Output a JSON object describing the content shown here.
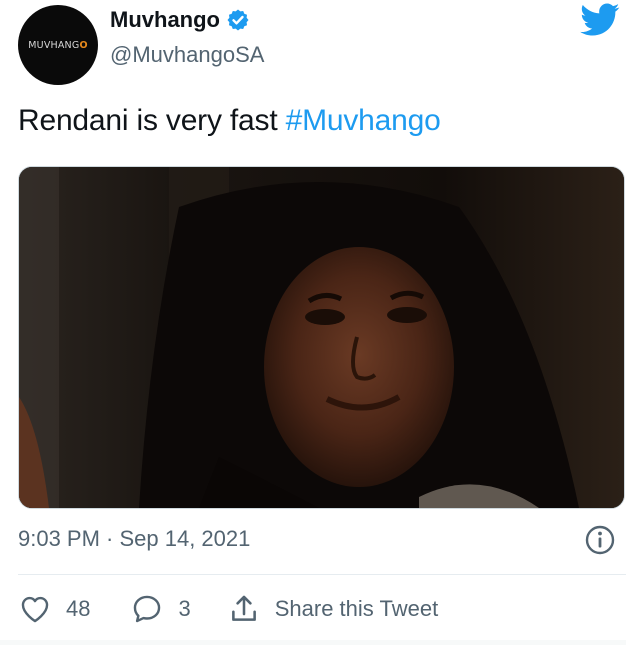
{
  "account": {
    "display_name": "Muvhango",
    "handle": "@MuvhangoSA",
    "avatar_wordmark": "MUVHANG",
    "avatar_wordmark_o": "O",
    "verified": true
  },
  "tweet": {
    "text": "Rendani is very fast ",
    "hashtag": "#Muvhango",
    "timestamp": "9:03 PM · Sep 14, 2021"
  },
  "actions": {
    "likes": "48",
    "replies": "3",
    "share_label": "Share this Tweet"
  },
  "icons": {
    "brand": "twitter-bird-icon",
    "verified": "verified-badge-icon",
    "info": "info-icon",
    "like": "heart-icon",
    "reply": "reply-bubble-icon",
    "share": "share-icon"
  },
  "colors": {
    "link": "#1d9bf0",
    "secondary_text": "#536471",
    "primary_text": "#0f1419",
    "avatar_bg": "#0a0a0a",
    "avatar_accent": "#e8891c"
  }
}
